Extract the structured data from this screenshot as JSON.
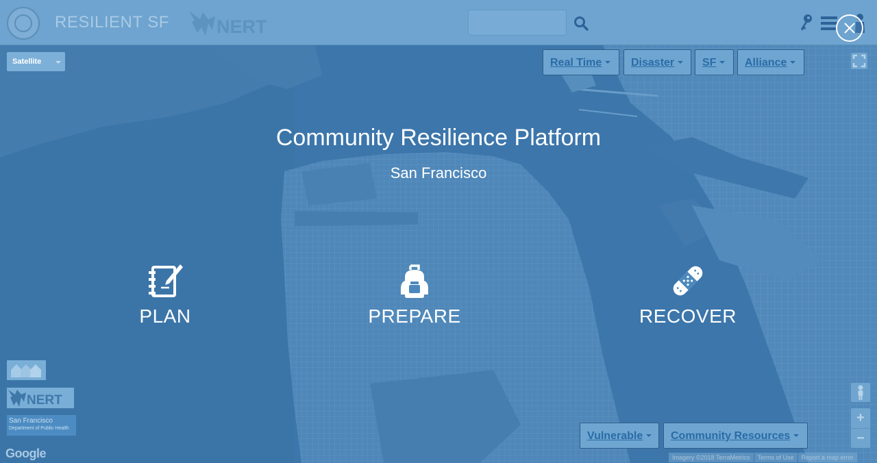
{
  "header": {
    "brand_title": "RESILIENT SF",
    "nert_logo_text": "NERT",
    "search": {
      "value": "",
      "placeholder": ""
    }
  },
  "map": {
    "map_type": "Satellite",
    "top_menus": [
      "Real Time",
      "Disaster",
      "SF",
      "Alliance"
    ],
    "bottom_menus": [
      "Vulnerable",
      "Community Resources"
    ],
    "zoom_in_label": "+",
    "zoom_out_label": "−",
    "google_label": "Google",
    "attribution": [
      "Imagery ©2018 TerraMetrics",
      "Terms of Use",
      "Report a map error"
    ]
  },
  "partners": {
    "nert_text": "NERT",
    "dph_line1": "San Francisco",
    "dph_line2": "Department of Public Health"
  },
  "overlay": {
    "title": "Community Resilience Platform",
    "subtitle": "San Francisco",
    "actions": [
      {
        "label": "PLAN",
        "icon": "notebook-pen-icon"
      },
      {
        "label": "PREPARE",
        "icon": "backpack-icon"
      },
      {
        "label": "RECOVER",
        "icon": "bandage-icon"
      }
    ]
  },
  "colors": {
    "overlay_tint": "#3f7fb8",
    "header_bg": "#6ea4cf",
    "link_text": "#2a6ba6",
    "text_white": "#ffffff"
  }
}
